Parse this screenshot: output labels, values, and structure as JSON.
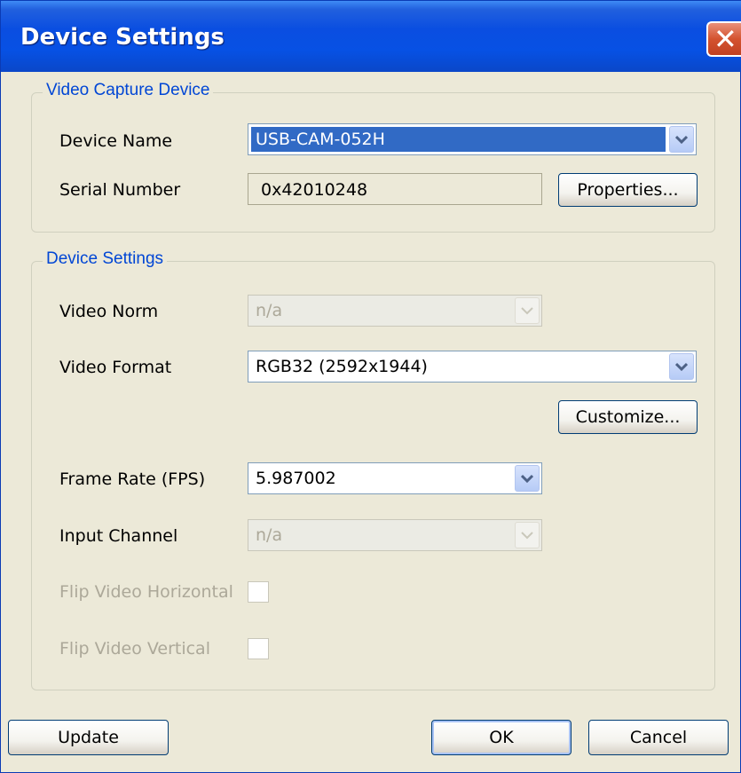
{
  "window": {
    "title": "Device Settings",
    "close_glyph": "✕"
  },
  "capture_group": {
    "title": "Video Capture Device",
    "device_name_label": "Device Name",
    "device_name_value": "USB-CAM-052H",
    "serial_label": "Serial Number",
    "serial_value": "0x42010248",
    "properties_button": "Properties..."
  },
  "settings_group": {
    "title": "Device Settings",
    "video_norm_label": "Video Norm",
    "video_norm_value": "n/a",
    "video_format_label": "Video Format",
    "video_format_value": "RGB32 (2592x1944)",
    "customize_button": "Customize...",
    "frame_rate_label": "Frame Rate (FPS)",
    "frame_rate_value": "5.987002",
    "input_channel_label": "Input Channel",
    "input_channel_value": "n/a",
    "flip_h_label": "Flip Video Horizontal",
    "flip_v_label": "Flip Video Vertical"
  },
  "footer": {
    "update_button": "Update",
    "ok_button": "OK",
    "cancel_button": "Cancel"
  },
  "colors": {
    "group_title": "#0046d5",
    "selection": "#316ac5",
    "window_bg": "#ece9d8"
  },
  "icons": {
    "dropdown": "chevron-down-icon",
    "close": "close-icon"
  }
}
